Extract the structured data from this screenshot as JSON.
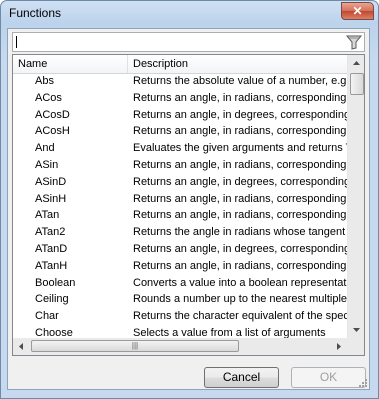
{
  "window": {
    "title": "Functions",
    "close_glyph": "✕"
  },
  "search": {
    "value": "",
    "placeholder": "",
    "icon": "filter-icon"
  },
  "grid": {
    "columns": [
      "Name",
      "Description"
    ],
    "rows": [
      {
        "name": "Abs",
        "description": "Returns the absolute value of a number, e.g."
      },
      {
        "name": "ACos",
        "description": "Returns an angle, in radians, corresponding t"
      },
      {
        "name": "ACosD",
        "description": "Returns an angle, in degrees, corresponding"
      },
      {
        "name": "ACosH",
        "description": "Returns an angle, in radians, corresponding t"
      },
      {
        "name": "And",
        "description": "Evaluates the given arguments and returns T"
      },
      {
        "name": "ASin",
        "description": "Returns an angle, in radians, corresponding t"
      },
      {
        "name": "ASinD",
        "description": "Returns an angle, in degrees, corresponding"
      },
      {
        "name": "ASinH",
        "description": "Returns an angle, in radians, corresponding t"
      },
      {
        "name": "ATan",
        "description": "Returns an angle, in radians, corresponding t"
      },
      {
        "name": "ATan2",
        "description": "Returns the angle in radians whose tangent i"
      },
      {
        "name": "ATanD",
        "description": "Returns an angle, in degrees, corresponding"
      },
      {
        "name": "ATanH",
        "description": "Returns an angle, in radians, corresponding t"
      },
      {
        "name": "Boolean",
        "description": "Converts a value into a boolean representati"
      },
      {
        "name": "Ceiling",
        "description": "Rounds a number up to the nearest multiple o"
      },
      {
        "name": "Char",
        "description": "Returns the character equivalent of the spec"
      },
      {
        "name": "Choose",
        "description": "Selects a value from a list of arguments"
      }
    ],
    "hscroll_grip": "|||"
  },
  "buttons": {
    "cancel": "Cancel",
    "ok": "OK"
  },
  "colors": {
    "title_bar": "#bcd3ec",
    "close": "#c4462c",
    "grid_border": "#828790"
  }
}
